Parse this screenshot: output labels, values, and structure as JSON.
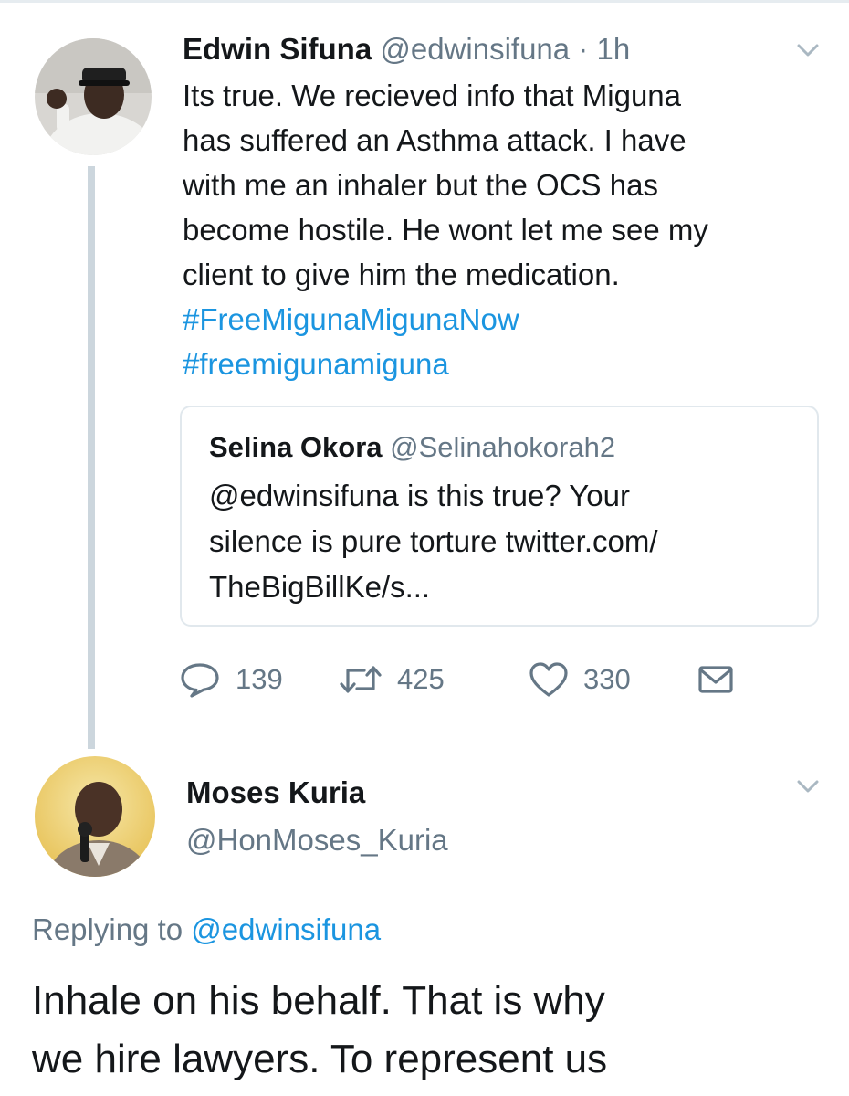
{
  "tweet": {
    "author_name": "Edwin Sifuna",
    "author_handle": "@edwinsifuna",
    "separator": "·",
    "time": "1h",
    "text_lines": [
      "Its true. We recieved info that Miguna",
      "has suffered an Asthma attack. I have",
      "with me an inhaler but the OCS has",
      "become hostile. He wont let me see my",
      "client to give him the medication."
    ],
    "hashtags": [
      "#FreeMigunaMigunaNow",
      "#freemigunamiguna"
    ],
    "quoted": {
      "author_name": "Selina Okora",
      "author_handle": "@Selinahokorah2",
      "text_lines": [
        "@edwinsifuna is this true? Your",
        "silence is pure torture twitter.com/",
        "TheBigBillKe/s..."
      ]
    },
    "actions": {
      "replies": "139",
      "retweets": "425",
      "likes": "330",
      "reply_icon": "reply-icon",
      "retweet_icon": "retweet-icon",
      "like_icon": "heart-icon",
      "dm_icon": "envelope-icon"
    }
  },
  "reply": {
    "author_name": "Moses Kuria",
    "author_handle": "@HonMoses_Kuria",
    "replying_prefix": "Replying to",
    "replying_to": "@edwinsifuna",
    "text_lines": [
      "Inhale on his behalf. That is why",
      "we hire lawyers. To represent us"
    ]
  },
  "colors": {
    "link": "#1b95e0",
    "muted": "#657786",
    "text": "#14171a",
    "thread_line": "#ccd6dd",
    "border": "#e1e8ed"
  }
}
